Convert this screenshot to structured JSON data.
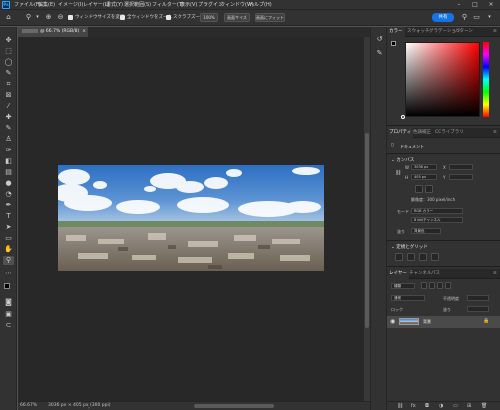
{
  "app": {
    "logo_text": "Ps"
  },
  "menus": [
    "ファイル(F)",
    "編集(E)",
    "イメージ(I)",
    "レイヤー(L)",
    "書式(Y)",
    "選択範囲(S)",
    "フィルター(T)",
    "表示(V)",
    "プラグイン",
    "ウィンドウ(W)",
    "ヘルプ(H)"
  ],
  "options": {
    "fit_windows": "ウィンドウサイズを変更",
    "all_windows": "全ウィンドウをズーム",
    "scrubby_zoom": "スクラブズーム",
    "zoom_100": "100%",
    "fit_screen": "画面サイズ",
    "fill_screen": "画面にフィット",
    "share": "共有"
  },
  "document": {
    "tab_title": "@ 66.7% (RGB/8)",
    "zoom": "66.67%",
    "status": "3036 px × 405 px (300 ppi)"
  },
  "color_panel": {
    "tabs": [
      "カラー",
      "スウォッチ",
      "グラデーション",
      "パターン"
    ],
    "hue_color": "#ff0000"
  },
  "properties_panel": {
    "tabs": [
      "プロパティ",
      "色調補正",
      "CCライブラリ"
    ],
    "doc_type": "ドキュメント",
    "canvas_title": "カンバス",
    "width": "3036 px",
    "height": "405 px",
    "x_label": "X",
    "y_label": "Y",
    "w_label": "W",
    "h_label": "H",
    "resolution": "解像度：300 pixel/inch",
    "mode_label": "モード",
    "mode_value": "RGB カラー",
    "bit_value": "8 bit/チャンネル",
    "fill_label": "塗り",
    "fill_value": "背景色",
    "guides_title": "定規とグリッド"
  },
  "layers_panel": {
    "tabs": [
      "レイヤー",
      "チャンネル",
      "パス"
    ],
    "kind_label": "種類",
    "blend_label": "通常",
    "opacity_label": "不透明度",
    "lock_label": "ロック",
    "fill_label": "塗り",
    "layer_name": "背景"
  }
}
